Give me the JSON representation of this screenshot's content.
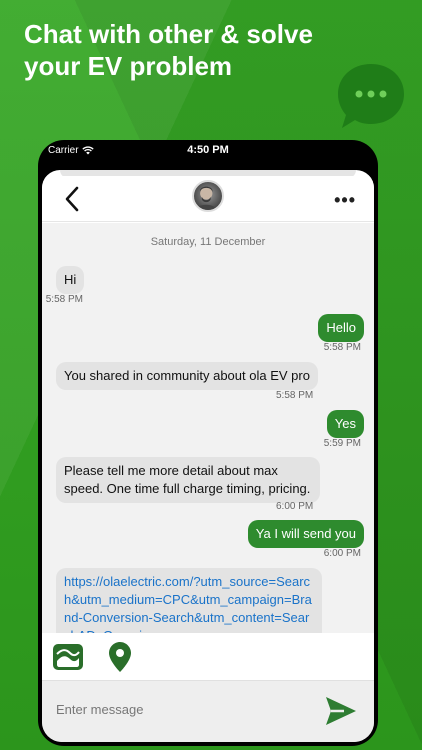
{
  "promo": {
    "headline": "Chat with other & solve your EV problem"
  },
  "status_bar": {
    "carrier": "Carrier",
    "time": "4:50 PM"
  },
  "chat": {
    "date_separator": "Saturday, 11 December",
    "messages": [
      {
        "direction": "incoming",
        "text": "Hi",
        "time": "5:58 PM"
      },
      {
        "direction": "outgoing",
        "text": "Hello",
        "time": "5:58 PM"
      },
      {
        "direction": "incoming",
        "text": "You shared in community about ola EV pro",
        "time": "5:58 PM"
      },
      {
        "direction": "outgoing",
        "text": "Yes",
        "time": "5:59 PM"
      },
      {
        "direction": "incoming",
        "text": "Please tell me more detail about max speed. One time full charge timing, pricing.",
        "time": "6:00 PM"
      },
      {
        "direction": "outgoing",
        "text": "Ya I will send you",
        "time": "6:00 PM"
      },
      {
        "direction": "incoming",
        "text": "https://olaelectric.com/?utm_source=Search&utm_medium=CPC&utm_campaign=Brand-Conversion-Search&utm_content=SearchAD_Generic_",
        "is_link": true
      }
    ]
  },
  "composer": {
    "placeholder": "Enter message"
  },
  "colors": {
    "brand_green": "#2e8b2e",
    "background_green": "#2f9b1f",
    "link_blue": "#1a73c9"
  },
  "icons": {
    "back": "chevron-left-icon",
    "more": "more-horizontal-icon",
    "gallery": "gallery-icon",
    "location": "location-pin-icon",
    "send": "send-icon",
    "promo_bubble": "chat-bubble-icon"
  }
}
